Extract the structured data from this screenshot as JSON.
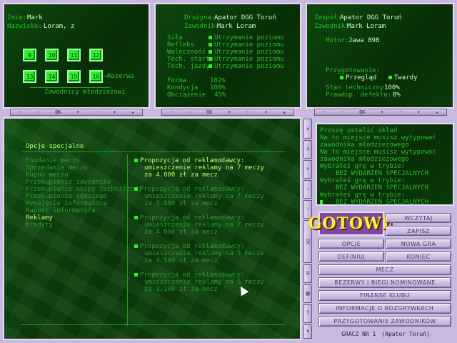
{
  "player_panel": {
    "imie_label": "Imię:",
    "imie": "Mark",
    "nazwisko_label": "Nazwisko:",
    "nazwisko": "Loram, z",
    "squares_row1": [
      "9",
      "10",
      "11",
      "12"
    ],
    "squares_row2": [
      "13",
      "14",
      "15",
      "16"
    ],
    "rezerwa": "Rezerwa",
    "mlodziez": "Zawodnicy młodzieżowi"
  },
  "team_panel": {
    "druzyna_label": "Drużyna:",
    "druzyna": "Apator DGG Toruń",
    "zawodnik_label": "Zawodnik:",
    "zawodnik": "Mark Loram",
    "stats": [
      {
        "label": "Siła",
        "value": "Utrzymanie poziomu"
      },
      {
        "label": "Refleks",
        "value": "Utrzymanie poziomu"
      },
      {
        "label": "Waleczność",
        "value": "Utrzymanie poziomu"
      },
      {
        "label": "Tech. startu",
        "value": "Utrzymanie poziomu"
      },
      {
        "label": "Tech. jazdy",
        "value": "Utrzymanie poziomu"
      }
    ],
    "forma_label": "Forma",
    "forma": "102%",
    "kondycja_label": "Kondycja",
    "kondycja": "100%",
    "obciazenie_label": "Obciążenie",
    "obciazenie": "45%"
  },
  "moto_panel": {
    "zespol_label": "Zespół:",
    "zespol": "Apator DGG Toruń",
    "zawodnik_label": "Zawodnik:",
    "zawodnik": "Mark Loram",
    "motor_label": "Motor:",
    "motor": "Jawa 898",
    "przygotowanie": "Przygotowanie:",
    "przeglad": "Przegląd",
    "twardy": "Twardy",
    "stan_label": "Stan techniczny",
    "stan": "100%",
    "defekt_label": "Prawdop. defektu:",
    "defekt": "0%"
  },
  "bars": {
    "ok": "OK",
    "plus": "+",
    "minus": "-"
  },
  "options": {
    "title": "Opcje specjalne",
    "menu": [
      "Poddanie meczu",
      "Sprzedanie meczu",
      "Kupno meczu",
      "Przekupienie zawodnika",
      "Przekupienie ekipy technicznej",
      "Przekupienie sędziego",
      "Wynajęcie informatora",
      "Raport informatora",
      "Reklamy",
      "Kredyty"
    ],
    "selected": "Reklamy",
    "offers": [
      {
        "l1": "Propozycja od reklamodawcy:",
        "l2": "umieszczenie reklamy na 7 meczy",
        "l3": "za 4.000 zł za mecz",
        "active": true
      },
      {
        "l1": "Propozycja od reklamodawcy:",
        "l2": "umieszczenie reklamy na 7 meczy",
        "l3": "za 3.800 zł za mecz",
        "active": false
      },
      {
        "l1": "Propozycja od reklamodawcy:",
        "l2": "umieszczenie reklamy na 7 meczy",
        "l3": "za 4.000 zł za mecz",
        "active": false
      },
      {
        "l1": "Propozycja od reklamodawcy:",
        "l2": "umieszczenie reklamy na 3 mecze",
        "l3": "za 4.500 zł za mecz",
        "active": false
      },
      {
        "l1": "Propozycja od reklamodawcy:",
        "l2": "umieszczenie reklamy na 5 meczy",
        "l3": "za 3.200 zł za mecz",
        "active": false
      }
    ]
  },
  "side_buttons": {
    "plus": "+",
    "minus": "-",
    "ok": "OK",
    "question": "?"
  },
  "messages": [
    {
      "text": "Proszę ustalić skład",
      "indent": false
    },
    {
      "text": "Na to miejsce musisz wytypować",
      "indent": false
    },
    {
      "text": "zawodnika młodzieżowego",
      "indent": false
    },
    {
      "text": "Na to miejsce musisz wytypować",
      "indent": false
    },
    {
      "text": "zawodnika młodzieżowego",
      "indent": false
    },
    {
      "text": "Wybrałeś grę w trybie:",
      "indent": false
    },
    {
      "text": "BEZ WYDARZEŃ SPECJALNYCH",
      "indent": true
    },
    {
      "text": "Wybrałeś grę w trybie:",
      "indent": false
    },
    {
      "text": "BEZ WYDARZEŃ SPECJALNYCH",
      "indent": true
    },
    {
      "text": "Wybrałeś grę w trybie:",
      "indent": false
    },
    {
      "text": "BEZ WYDARZEŃ SPECJALNYCH",
      "indent": true
    }
  ],
  "menu": {
    "gotowe": "GOTOWE",
    "wczytaj": "WCZYTAJ",
    "zapisz": "ZAPISZ",
    "opcje": "OPCJE",
    "nowa_gra": "NOWA GRA",
    "definiuj": "DEFINIUJ",
    "koniec": "KONIEC",
    "mecz": "MECZ",
    "rezerwy": "REZERWY I BIEGI NOMINOWANE",
    "finanse": "FINANSE KLUBU",
    "informacje": "INFORMACJE O ROZGRYWKACH",
    "przygotowanie": "PRZYGOTOWANIE ZAWODNIKÓW"
  },
  "status": {
    "gracz": "GRACZ NR 1",
    "team": "(Apator Toruń)"
  }
}
